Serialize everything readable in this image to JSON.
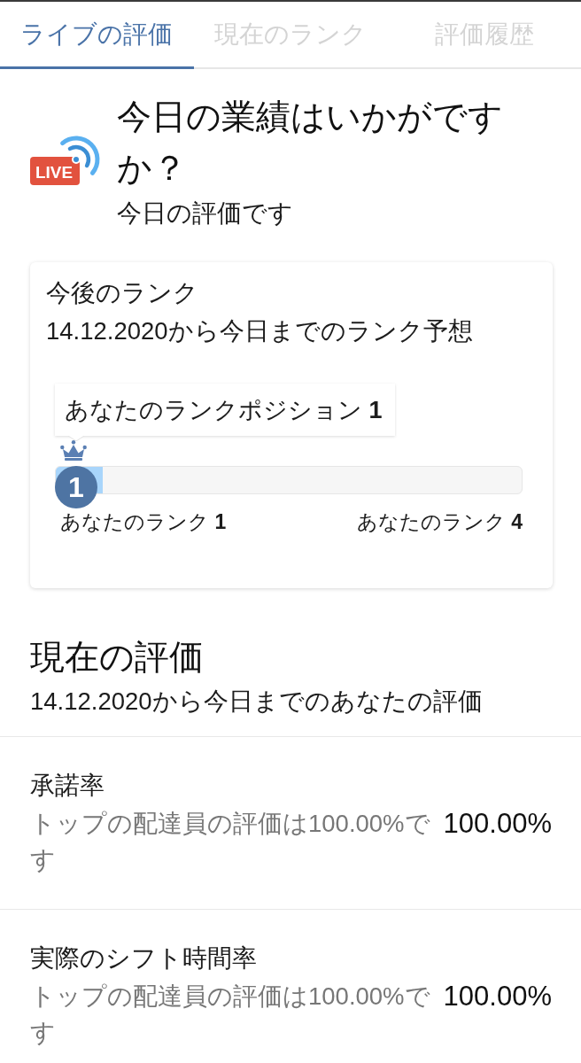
{
  "tabs": [
    {
      "label": "ライブの評価",
      "selected": true
    },
    {
      "label": "現在のランク",
      "selected": false
    },
    {
      "label": "評価履歴",
      "selected": false
    }
  ],
  "header": {
    "live_label": "LIVE",
    "title": "今日の業績はいかがですか？",
    "subtitle": "今日の評価です"
  },
  "rank_card": {
    "title": "今後のランク",
    "subtitle": "14.12.2020から今日までのランク予想",
    "tooltip": "あなたのランクポジション **1**",
    "badge": "1",
    "level": 0.1,
    "min_label": "あなたのランク **1**",
    "max_label": "あなたのランク **4**"
  },
  "rating": {
    "title": "現在の評価",
    "subtitle": "14.12.2020から今日までのあなたの評価",
    "metrics": [
      {
        "name": "承諾率",
        "description": "トップの配達員の評価は100.00%です",
        "value": "100.00%"
      },
      {
        "name": "実際のシフト時間率",
        "description": "トップの配達員の評価は100.00%です",
        "value": "100.00%"
      }
    ]
  }
}
